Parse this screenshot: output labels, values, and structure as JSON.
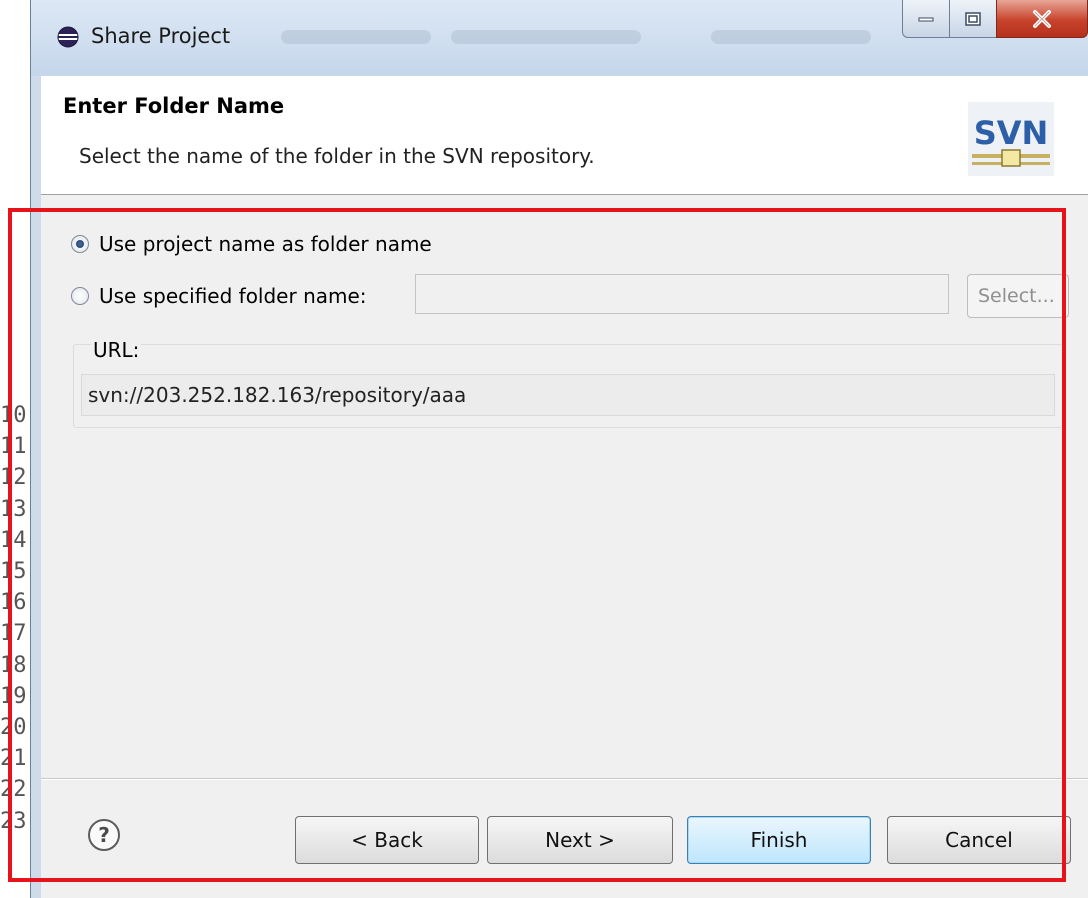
{
  "background": {
    "line_numbers": [
      "10",
      "11",
      "12",
      "13",
      "14",
      "15",
      "16",
      "17",
      "18",
      "19",
      "20",
      "21",
      "22",
      "23"
    ]
  },
  "window": {
    "title": "Share Project",
    "icon": "eclipse-icon",
    "controls": {
      "minimize": "minimize-icon",
      "maximize": "maximize-icon",
      "close": "close-icon"
    }
  },
  "header": {
    "title": "Enter Folder Name",
    "description": "Select the name of the folder in the SVN repository.",
    "logo_text": "SVN"
  },
  "options": {
    "use_project_name": {
      "label": "Use project name as folder name",
      "selected": true
    },
    "use_specified_name": {
      "label": "Use specified folder name:",
      "selected": false,
      "value": ""
    },
    "select_button": "Select..."
  },
  "url": {
    "label": "URL:",
    "value": "svn://203.252.182.163/repository/aaa"
  },
  "buttons": {
    "help": "help-icon",
    "back": "< Back",
    "next": "Next >",
    "finish": "Finish",
    "cancel": "Cancel"
  },
  "colors": {
    "highlight_box": "#e5141b",
    "default_button": "#bee6fd"
  }
}
